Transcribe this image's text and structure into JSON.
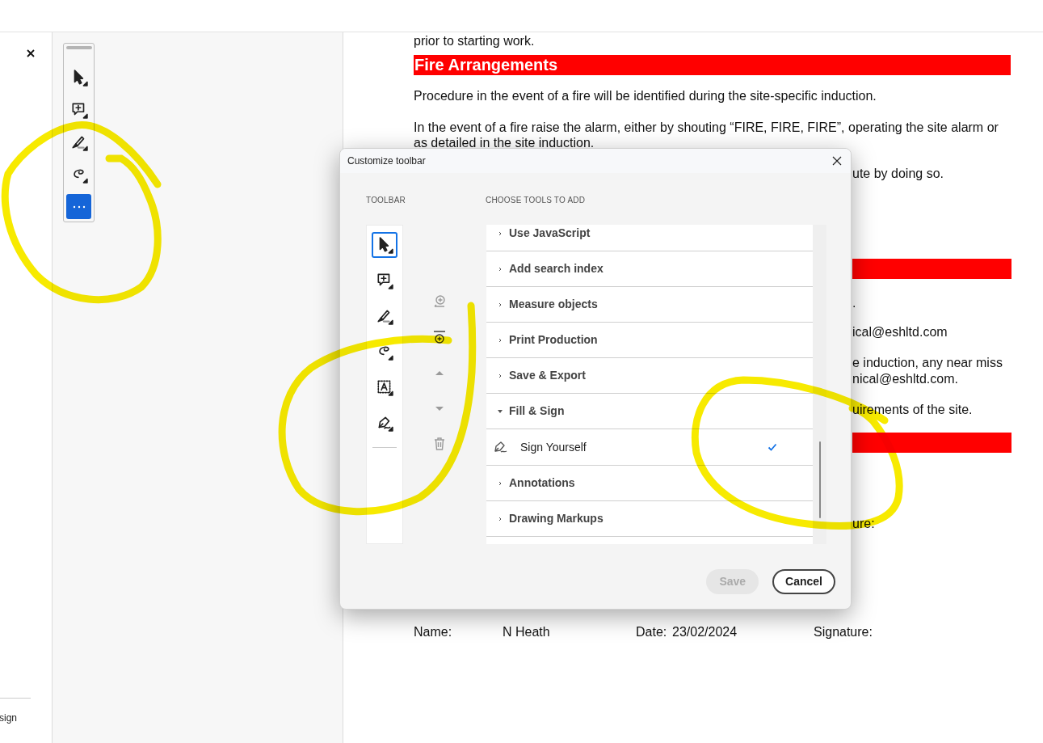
{
  "left_panel": {
    "bottom_text": "sign"
  },
  "floating_toolbar": {
    "tools": [
      {
        "kind": "select",
        "selected": false
      },
      {
        "kind": "comment",
        "selected": false
      },
      {
        "kind": "highlight",
        "selected": false
      },
      {
        "kind": "lasso",
        "selected": false
      },
      {
        "kind": "more",
        "selected": true
      }
    ]
  },
  "document": {
    "blocks": [
      {
        "kind": "line",
        "text": "prior to starting work."
      },
      {
        "kind": "heading",
        "text": "Fire Arrangements"
      },
      {
        "kind": "line",
        "text": "Procedure in the event of a fire will be identified during the site-specific induction."
      },
      {
        "kind": "line",
        "text": "In the event of a fire raise the alarm, either by shouting “FIRE, FIRE, FIRE”, operating the site alarm or as detailed in the site induction."
      },
      {
        "kind": "fragment",
        "text": "ute by doing so."
      },
      {
        "kind": "red_bar"
      },
      {
        "kind": "fragment",
        "text": "."
      },
      {
        "kind": "fragment",
        "text": "ical@eshltd.com"
      },
      {
        "kind": "fragment",
        "text": "e induction, any near miss"
      },
      {
        "kind": "fragment",
        "text": "nical@eshltd.com."
      },
      {
        "kind": "fragment",
        "text": "uirements of the site."
      },
      {
        "kind": "red_bar"
      },
      {
        "kind": "fragment",
        "text": "ure:"
      },
      {
        "kind": "signature_row",
        "cells": [
          "Name:",
          "N Heath",
          "Date:",
          "23/02/2024",
          "Signature:"
        ]
      }
    ]
  },
  "dialog": {
    "title": "Customize toolbar",
    "toolbar_label": "TOOLBAR",
    "choose_label": "CHOOSE TOOLS TO ADD",
    "toolbar_tools": [
      {
        "kind": "select",
        "selected": true
      },
      {
        "kind": "comment",
        "selected": false
      },
      {
        "kind": "highlight",
        "selected": false
      },
      {
        "kind": "lasso",
        "selected": false
      },
      {
        "kind": "text_box",
        "selected": false
      },
      {
        "kind": "sign",
        "selected": false
      }
    ],
    "actions": [
      {
        "kind": "insert",
        "disabled": true
      },
      {
        "kind": "add",
        "disabled": false
      },
      {
        "kind": "up",
        "disabled": true
      },
      {
        "kind": "down",
        "disabled": true
      },
      {
        "kind": "delete",
        "disabled": true
      }
    ],
    "tool_groups": [
      {
        "label": "Use JavaScript",
        "expanded": false
      },
      {
        "label": "Add search index",
        "expanded": false
      },
      {
        "label": "Measure objects",
        "expanded": false
      },
      {
        "label": "Print Production",
        "expanded": false
      },
      {
        "label": "Save & Export",
        "expanded": false
      },
      {
        "label": "Fill & Sign",
        "expanded": true,
        "children": [
          {
            "label": "Sign Yourself",
            "checked": true
          }
        ]
      },
      {
        "label": "Annotations",
        "expanded": false
      },
      {
        "label": "Drawing Markups",
        "expanded": false
      }
    ],
    "buttons": [
      {
        "label": "Save",
        "disabled": true
      },
      {
        "label": "Cancel",
        "disabled": false
      }
    ]
  }
}
